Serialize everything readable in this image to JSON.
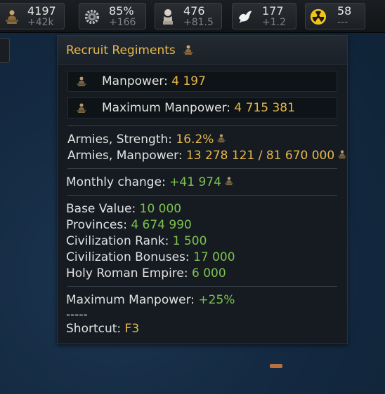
{
  "topbar": {
    "manpower": {
      "value": "4197",
      "change": "+42k",
      "icon": "soldier-icon"
    },
    "production": {
      "value": "85%",
      "change": "+166",
      "icon": "gear-icon"
    },
    "culture": {
      "value": "476",
      "change": "+81.5",
      "icon": "bust-icon"
    },
    "diplomacy": {
      "value": "177",
      "change": "+1.2",
      "icon": "dove-icon"
    },
    "nuclear": {
      "value": "58",
      "change": "---",
      "icon": "radiation-icon"
    }
  },
  "tooltip": {
    "title": "Recruit Regiments",
    "rows": [
      {
        "label": "Manpower: ",
        "value": "4 197"
      },
      {
        "label": "Maximum Manpower: ",
        "value": "4 715 381"
      }
    ],
    "armies_strength_label": "Armies, Strength: ",
    "armies_strength_value": "16.2%",
    "armies_manpower_label": "Armies, Manpower: ",
    "armies_manpower_value": "13 278 121 / 81 670 000",
    "monthly_change_label": "Monthly change: ",
    "monthly_change_value": "+41 974",
    "breakdown": [
      {
        "label": "Base Value: ",
        "value": "10 000"
      },
      {
        "label": "Provinces: ",
        "value": "4 674 990"
      },
      {
        "label": "Civilization Rank: ",
        "value": "1 500"
      },
      {
        "label": "Civilization Bonuses: ",
        "value": "17 000"
      },
      {
        "label": "Holy Roman Empire: ",
        "value": "6 000"
      }
    ],
    "max_manpower_label": "Maximum Manpower: ",
    "max_manpower_value": "+25%",
    "dashes": "-----",
    "shortcut_label": "Shortcut: ",
    "shortcut_value": "F3"
  },
  "colors": {
    "gold": "#e6b84a",
    "green": "#7ec24d",
    "text": "#e2e2e2"
  }
}
